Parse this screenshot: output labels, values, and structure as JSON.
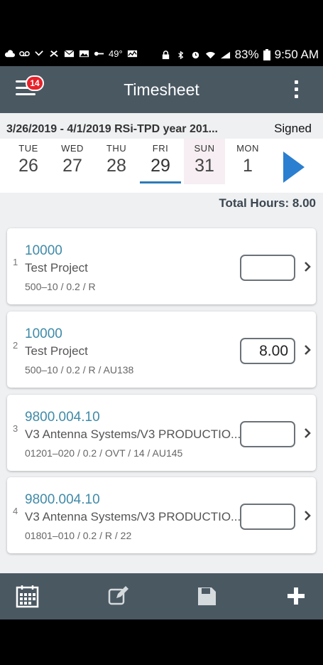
{
  "status_bar": {
    "temperature": "49°",
    "battery": "83%",
    "time": "9:50 AM"
  },
  "app_bar": {
    "title": "Timesheet",
    "badge_count": "14"
  },
  "range": {
    "text": "3/26/2019 - 4/1/2019 RSi-TPD year 201...",
    "status": "Signed"
  },
  "days": [
    {
      "name": "TUE",
      "date": "26"
    },
    {
      "name": "WED",
      "date": "27"
    },
    {
      "name": "THU",
      "date": "28"
    },
    {
      "name": "FRI",
      "date": "29"
    },
    {
      "name": "SUN",
      "date": "31"
    },
    {
      "name": "MON",
      "date": "1"
    }
  ],
  "total_hours": "Total Hours: 8.00",
  "entries": [
    {
      "index": "1",
      "code": "10000",
      "name": "Test Project",
      "sub": "500–10 / 0.2 / R",
      "hours": ""
    },
    {
      "index": "2",
      "code": "10000",
      "name": "Test Project",
      "sub": "500–10 / 0.2 / R / AU138",
      "hours": "8.00"
    },
    {
      "index": "3",
      "code": "9800.004.10",
      "name": "V3 Antenna Systems/V3 PRODUCTIO...",
      "sub": "01201–020 / 0.2 / OVT / 14 / AU145",
      "hours": ""
    },
    {
      "index": "4",
      "code": "9800.004.10",
      "name": "V3 Antenna Systems/V3 PRODUCTIO...",
      "sub": "01801–010 / 0.2 / R / 22",
      "hours": ""
    }
  ],
  "colors": {
    "app_bar": "#4a5862",
    "accent_blue": "#2a7fd1",
    "code_text": "#3f8aa8",
    "badge": "#e8212a"
  }
}
